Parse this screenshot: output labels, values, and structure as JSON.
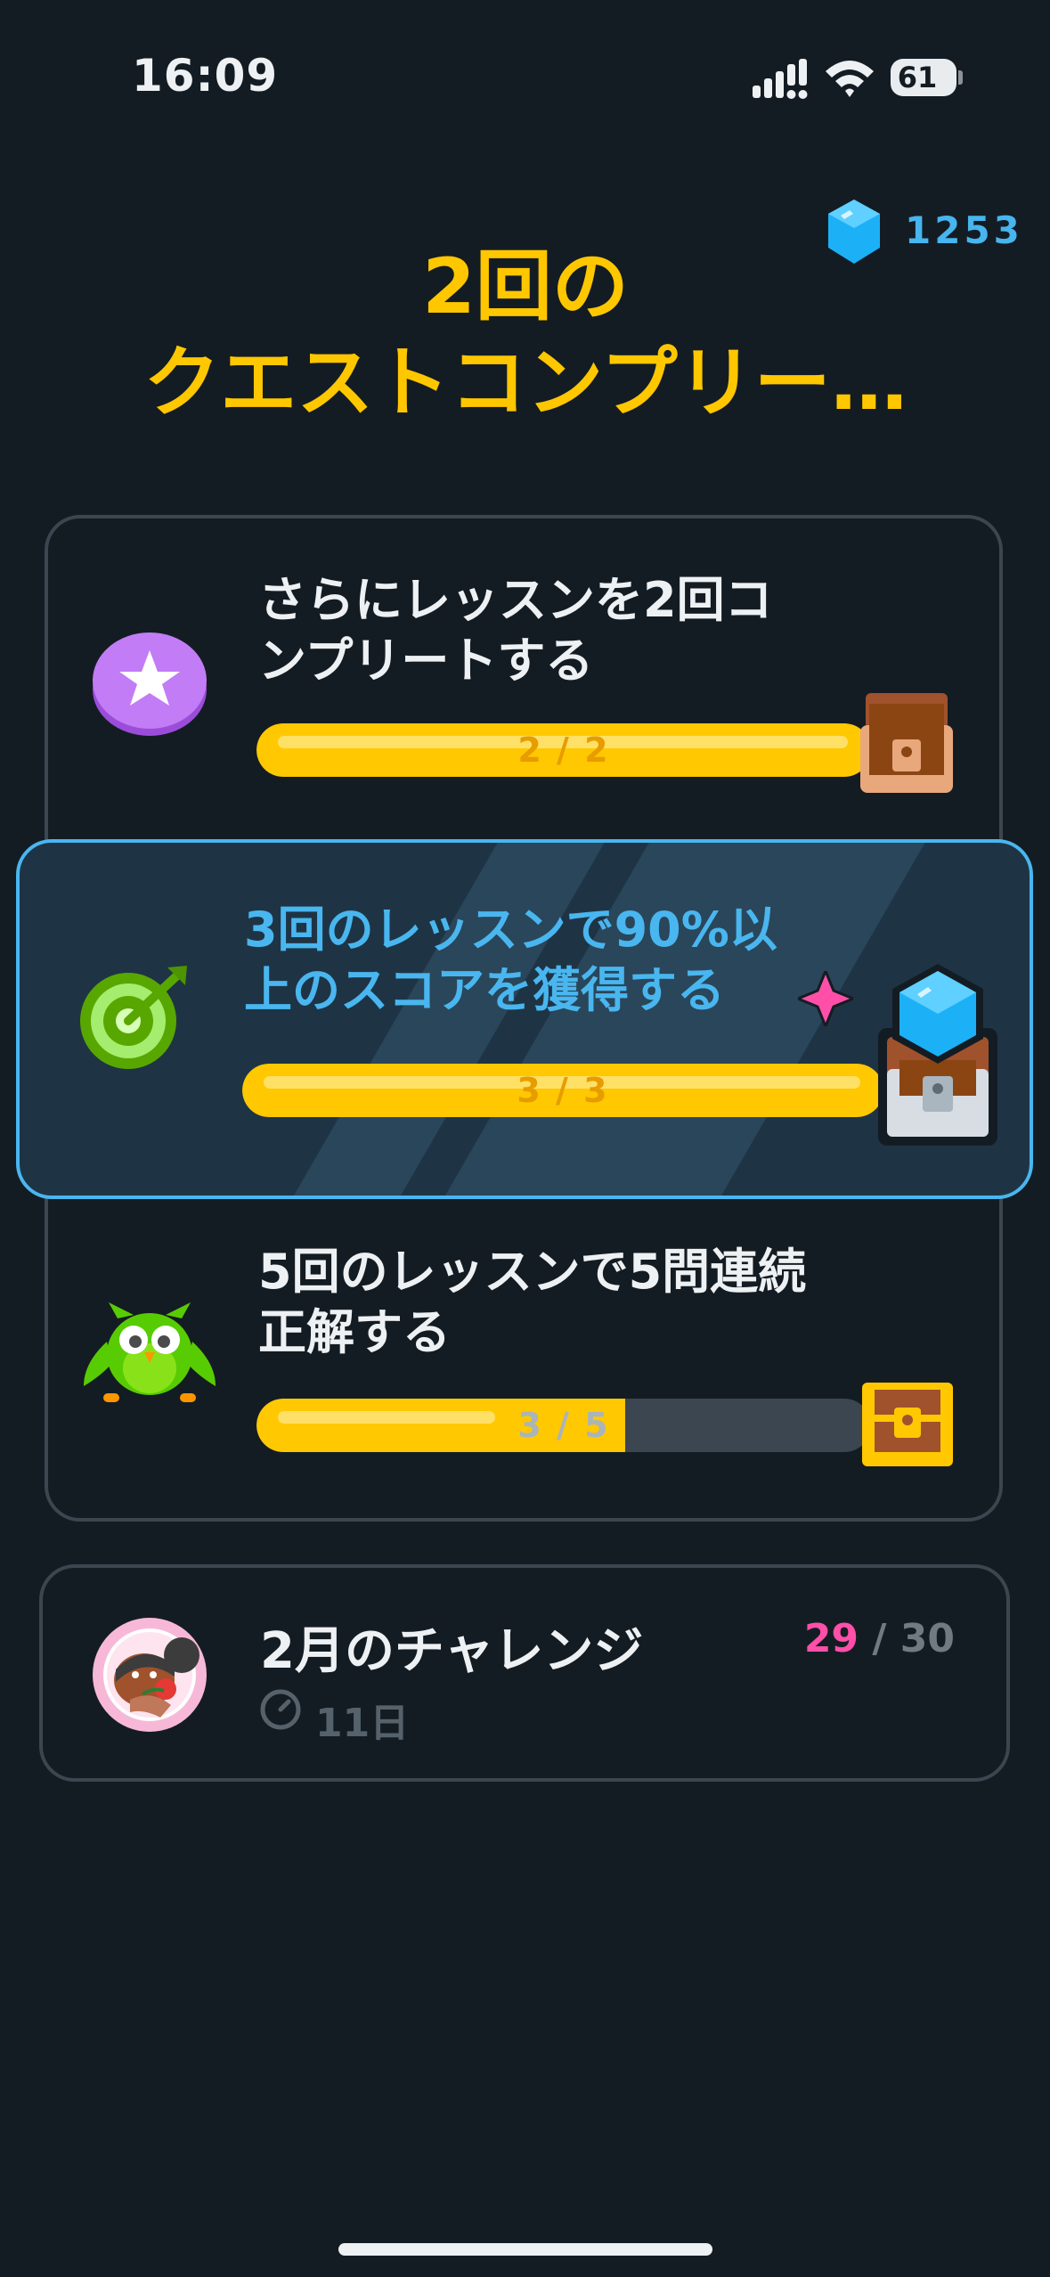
{
  "status_bar": {
    "time": "16:09",
    "battery": "61"
  },
  "gems": {
    "count": "1253",
    "icon": "gem-icon"
  },
  "title": "2回の\nクエストコンプリー…",
  "quests": [
    {
      "title": "さらにレッスンを2回コンプリートする",
      "line1": "さらにレッスンを2回コ",
      "line2": "ンプリートする",
      "progress_label": "2 / 2",
      "progress": 1.0,
      "icon": "star-badge-icon",
      "reward_icon": "chest-opened-icon"
    },
    {
      "title": "3回のレッスンで90%以上のスコアを獲得する",
      "line1": "3回のレッスンで90%以",
      "line2": "上のスコアを獲得する",
      "progress_label": "3 / 3",
      "progress": 1.0,
      "icon": "target-icon",
      "reward_icon": "chest-gem-icon"
    },
    {
      "title": "5回のレッスンで5問連続正解する",
      "line1": "5回のレッスンで5問連続",
      "line2": "正解する",
      "progress_label": "3 / 5",
      "progress": 0.6,
      "icon": "owl-icon",
      "reward_icon": "chest-gold-icon"
    }
  ],
  "challenge": {
    "title": "2月のチャレンジ",
    "current": "29",
    "separator": " / ",
    "total": "30",
    "time_left": "11日",
    "icon": "timer-icon"
  },
  "colors": {
    "accent": "#ffc700",
    "gem": "#47b5ee",
    "highlight": "#49b6ef",
    "pink": "#ff4fa8"
  }
}
